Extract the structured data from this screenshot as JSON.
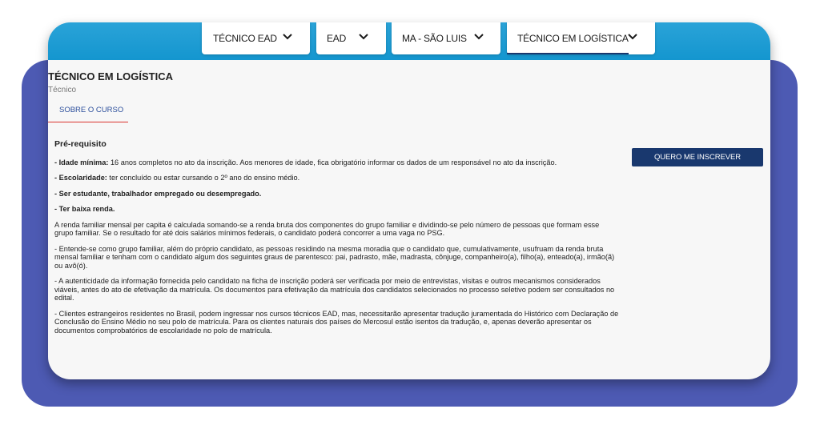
{
  "filters": [
    {
      "label": "TÉCNICO EAD"
    },
    {
      "label": "EAD"
    },
    {
      "label": "MA - SÃO LUIS"
    },
    {
      "label": "TÉCNICO EM LOGÍSTICA"
    }
  ],
  "course": {
    "title": "TÉCNICO EM LOGÍSTICA",
    "subtitle": "Técnico"
  },
  "tab": {
    "label": "SOBRE O CURSO"
  },
  "cta": {
    "label": "QUERO ME INSCREVER"
  },
  "content": {
    "heading": "Pré-requisito",
    "p1_bold": "- Idade mínima:",
    "p1_text": " 16 anos completos no ato da inscrição. Aos menores de idade, fica obrigatório informar os dados de um responsável no ato da inscrição.",
    "p2_bold": "- Escolaridade:",
    "p2_text": " ter concluído ou estar cursando o 2º ano do ensino médio.",
    "p3": "- Ser estudante, trabalhador empregado ou desempregado.",
    "p4": "- Ter baixa renda.",
    "p5": "A renda familiar mensal per capita é calculada somando-se a renda bruta dos componentes do grupo familiar e dividindo-se pelo número de pessoas que formam esse grupo familiar. Se o resultado for até dois salários mínimos federais, o candidato poderá concorrer a uma vaga no PSG.",
    "p6": "- Entende-se como grupo familiar, além do próprio candidato, as pessoas residindo na mesma moradia que o candidato que, cumulativamente, usufruam da renda bruta mensal familiar e tenham com o candidato algum dos seguintes graus de parentesco: pai, padrasto, mãe, madrasta, cônjuge, companheiro(a), filho(a), enteado(a), irmão(ã) ou avô(ó).",
    "p7": "- A autenticidade da informação fornecida pelo candidato na ficha de inscrição poderá ser verificada por meio de entrevistas, visitas e outros mecanismos considerados viáveis, antes do ato de efetivação da matrícula. Os documentos para efetivação da matrícula dos candidatos selecionados no processo seletivo podem ser consultados no edital.",
    "p8": "- Clientes estrangeiros residentes no Brasil, podem ingressar nos cursos técnicos EAD, mas, necessitarão apresentar tradução juramentada do Histórico com Declaração de Conclusão do Ensino Médio no seu polo de matrícula. Para os clientes naturais dos países do Mercosul estão isentos da tradução, e, apenas deverão apresentar os documentos comprobatórios de escolaridade no polo de matrícula."
  },
  "colors": {
    "frame": "#4d5ab3",
    "topbar": "#1e9bd3",
    "primary": "#19386e",
    "tab_underline": "#d9332e"
  },
  "icons": {
    "dropdown": "chevron-down-icon"
  }
}
